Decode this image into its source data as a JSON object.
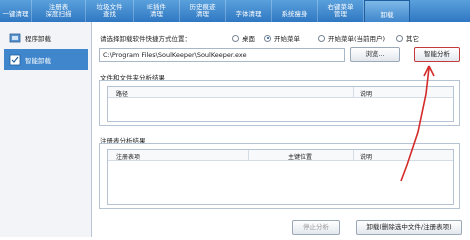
{
  "top_tabs": [
    {
      "label": "一键清理"
    },
    {
      "label": "注册表\n深度扫描"
    },
    {
      "label": "垃圾文件\n查找"
    },
    {
      "label": "IE插件\n清理"
    },
    {
      "label": "历史痕迹\n清理"
    },
    {
      "label": "字体清理"
    },
    {
      "label": "系统瘦身"
    },
    {
      "label": "右键菜单\n管理"
    },
    {
      "label": "卸载"
    }
  ],
  "sidebar": {
    "items": [
      {
        "label": "程序卸载",
        "icon": "uninstall-box-icon"
      },
      {
        "label": "智能卸载",
        "icon": "smart-uninstall-icon"
      }
    ]
  },
  "shortcut": {
    "prompt": "请选择卸载软件快捷方式位置：",
    "options": [
      {
        "label": "桌面",
        "selected": false
      },
      {
        "label": "开始菜单",
        "selected": true
      },
      {
        "label": "开始菜单(当前用户)",
        "selected": false
      },
      {
        "label": "其它",
        "selected": false
      }
    ],
    "path_value": "C:\\Program Files\\SoulKeeper\\SoulKeeper.exe",
    "browse_label": "浏览...",
    "analyze_label": "智能分析"
  },
  "files_panel": {
    "title": "文件和文件夹分析结果",
    "columns": [
      "路径",
      "说明"
    ]
  },
  "registry_panel": {
    "title": "注册表分析结果",
    "columns": [
      "注册表项",
      "主键位置",
      "说明"
    ]
  },
  "footer": {
    "stop_label": "停止分析",
    "uninstall_label": "卸载(删除选中文件/注册表项)"
  },
  "colors": {
    "accent": "#3f86cc",
    "annotation_arrow": "#d42a2a"
  }
}
